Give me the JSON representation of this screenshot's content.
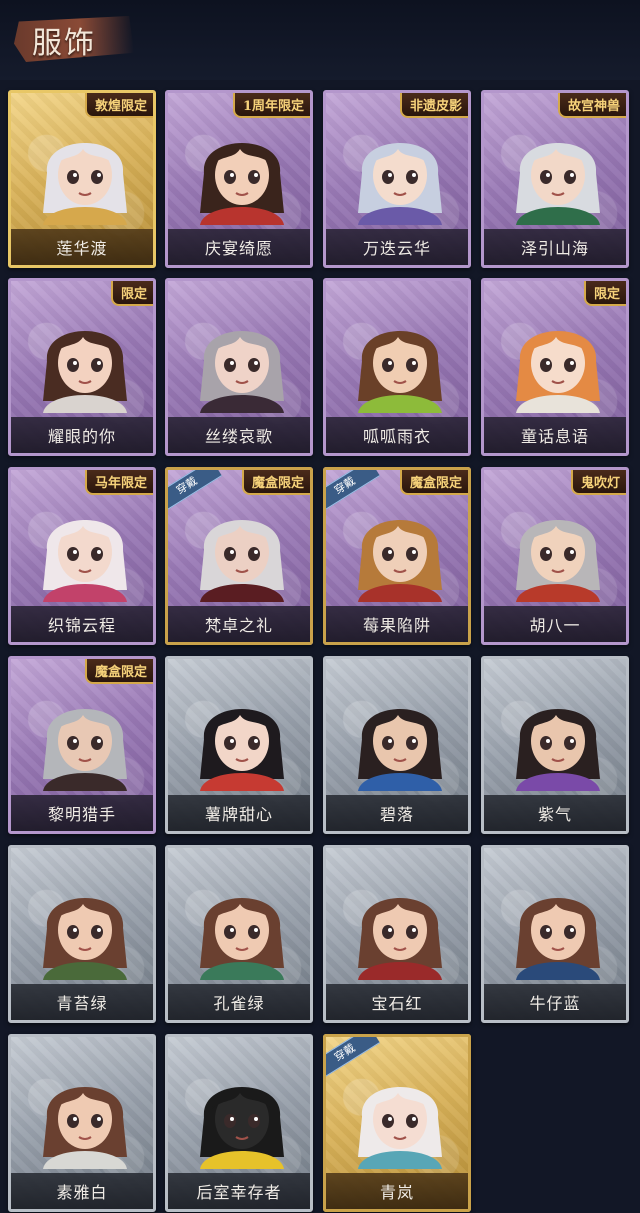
{
  "page": {
    "title": "服饰"
  },
  "colors": {
    "background": "#121726",
    "badge_text": "#f6d27a",
    "equip_tag": "#3a5c86"
  },
  "costumes": [
    {
      "name": "莲华渡",
      "rarity": "gold",
      "badge": "敦煌限定",
      "equipped": false,
      "hair": "#e4e2e8",
      "skin": "#f3d7c6",
      "outfit": "#d6a84c"
    },
    {
      "name": "庆宴绮愿",
      "rarity": "purple",
      "badge": "1周年限定",
      "equipped": false,
      "hair": "#3a241c",
      "skin": "#f2cfb8",
      "outfit": "#b8342e"
    },
    {
      "name": "万迭云华",
      "rarity": "purple",
      "badge": "非遗皮影",
      "equipped": false,
      "hair": "#c7cfe0",
      "skin": "#f4dccd",
      "outfit": "#6a5aa8"
    },
    {
      "name": "泽引山海",
      "rarity": "purple",
      "badge": "故宫神兽",
      "equipped": false,
      "hair": "#d8dbe0",
      "skin": "#f2d8c8",
      "outfit": "#2f6e4a"
    },
    {
      "name": "耀眼的你",
      "rarity": "purple",
      "badge": "限定",
      "equipped": false,
      "hair": "#4a2c22",
      "skin": "#f3d2c0",
      "outfit": "#d9d3cf"
    },
    {
      "name": "丝缕哀歌",
      "rarity": "purple",
      "badge": "",
      "equipped": false,
      "hair": "#a8a3aa",
      "skin": "#efd3c8",
      "outfit": "#3a2a36"
    },
    {
      "name": "呱呱雨衣",
      "rarity": "purple",
      "badge": "",
      "equipped": false,
      "hair": "#6a4028",
      "skin": "#f0cdb2",
      "outfit": "#8dbb3a"
    },
    {
      "name": "童话息语",
      "rarity": "purple",
      "badge": "限定",
      "equipped": false,
      "hair": "#e48a44",
      "skin": "#f6dccb",
      "outfit": "#e8e3da"
    },
    {
      "name": "织锦云程",
      "rarity": "purple",
      "badge": "马年限定",
      "equipped": false,
      "hair": "#efe7ea",
      "skin": "#f3d9cd",
      "outfit": "#c2426a"
    },
    {
      "name": "梵卓之礼",
      "rarity": "purple",
      "badge": "魔盒限定",
      "equipped": true,
      "hair": "#d9d6d8",
      "skin": "#ecd0c4",
      "outfit": "#5a1d22"
    },
    {
      "name": "莓果陷阱",
      "rarity": "purple",
      "badge": "魔盒限定",
      "equipped": true,
      "hair": "#b67a3a",
      "skin": "#efcfb8",
      "outfit": "#a8322a"
    },
    {
      "name": "胡八一",
      "rarity": "purple",
      "badge": "鬼吹灯",
      "equipped": false,
      "hair": "#b8b6b8",
      "skin": "#f0d2bc",
      "outfit": "#b83a2a"
    },
    {
      "name": "黎明猎手",
      "rarity": "purple",
      "badge": "魔盒限定",
      "equipped": false,
      "hair": "#b4b6ba",
      "skin": "#e8c8b4",
      "outfit": "#3a2a2a"
    },
    {
      "name": "薯牌甜心",
      "rarity": "grey",
      "badge": "",
      "equipped": false,
      "hair": "#1e1a1e",
      "skin": "#f2d6c8",
      "outfit": "#c63a32"
    },
    {
      "name": "碧落",
      "rarity": "grey",
      "badge": "",
      "equipped": false,
      "hair": "#2a2020",
      "skin": "#e9c6ad",
      "outfit": "#2f5fa8"
    },
    {
      "name": "紫气",
      "rarity": "grey",
      "badge": "",
      "equipped": false,
      "hair": "#2a2020",
      "skin": "#e9c6ad",
      "outfit": "#7a4aa8"
    },
    {
      "name": "青苔绿",
      "rarity": "grey",
      "badge": "",
      "equipped": false,
      "hair": "#6a4030",
      "skin": "#efcab2",
      "outfit": "#4a6a3a"
    },
    {
      "name": "孔雀绿",
      "rarity": "grey",
      "badge": "",
      "equipped": false,
      "hair": "#6a4030",
      "skin": "#efcab2",
      "outfit": "#3a7a5a"
    },
    {
      "name": "宝石红",
      "rarity": "grey",
      "badge": "",
      "equipped": false,
      "hair": "#6a4030",
      "skin": "#efcab2",
      "outfit": "#9a2a2a"
    },
    {
      "name": "牛仔蓝",
      "rarity": "grey",
      "badge": "",
      "equipped": false,
      "hair": "#6a4030",
      "skin": "#efcab2",
      "outfit": "#2a4a7a"
    },
    {
      "name": "素雅白",
      "rarity": "grey",
      "badge": "",
      "equipped": false,
      "hair": "#6a4030",
      "skin": "#efcab2",
      "outfit": "#d8d8d4"
    },
    {
      "name": "后室幸存者",
      "rarity": "grey",
      "badge": "",
      "equipped": false,
      "hair": "#1a1a1a",
      "skin": "#2a2a2a",
      "outfit": "#e6c22a"
    },
    {
      "name": "青岚",
      "rarity": "gold",
      "badge": "",
      "equipped": true,
      "hair": "#eeeaea",
      "skin": "#f5ddd2",
      "outfit": "#58a6b6"
    }
  ],
  "labels": {
    "equipped_tag": "穿戴"
  }
}
